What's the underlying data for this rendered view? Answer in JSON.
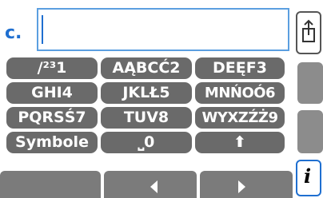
{
  "input": {
    "prefix": "c.",
    "value": ""
  },
  "keypad": {
    "rows": [
      [
        "/²³1",
        "AĄBCĆ2",
        "DEĘF3"
      ],
      [
        "GHI4",
        "JKLŁ5",
        "MNŃOÓ6"
      ],
      [
        "PQRSŚ7",
        "TUV8",
        "WYXZŹŻ9"
      ],
      [
        "Symbole",
        "⎵0",
        "⬆"
      ]
    ]
  },
  "side_buttons": {
    "share_icon": "share-icon",
    "info_glyph": "i",
    "info_icon": "info-icon"
  },
  "bottom_bar": {
    "left_icon": "arrow-left-icon",
    "right_icon": "arrow-right-icon"
  },
  "colors": {
    "accent": "#1f6fd0",
    "key_bg": "#6a6a6a",
    "side_bg": "#8c8c8c"
  }
}
